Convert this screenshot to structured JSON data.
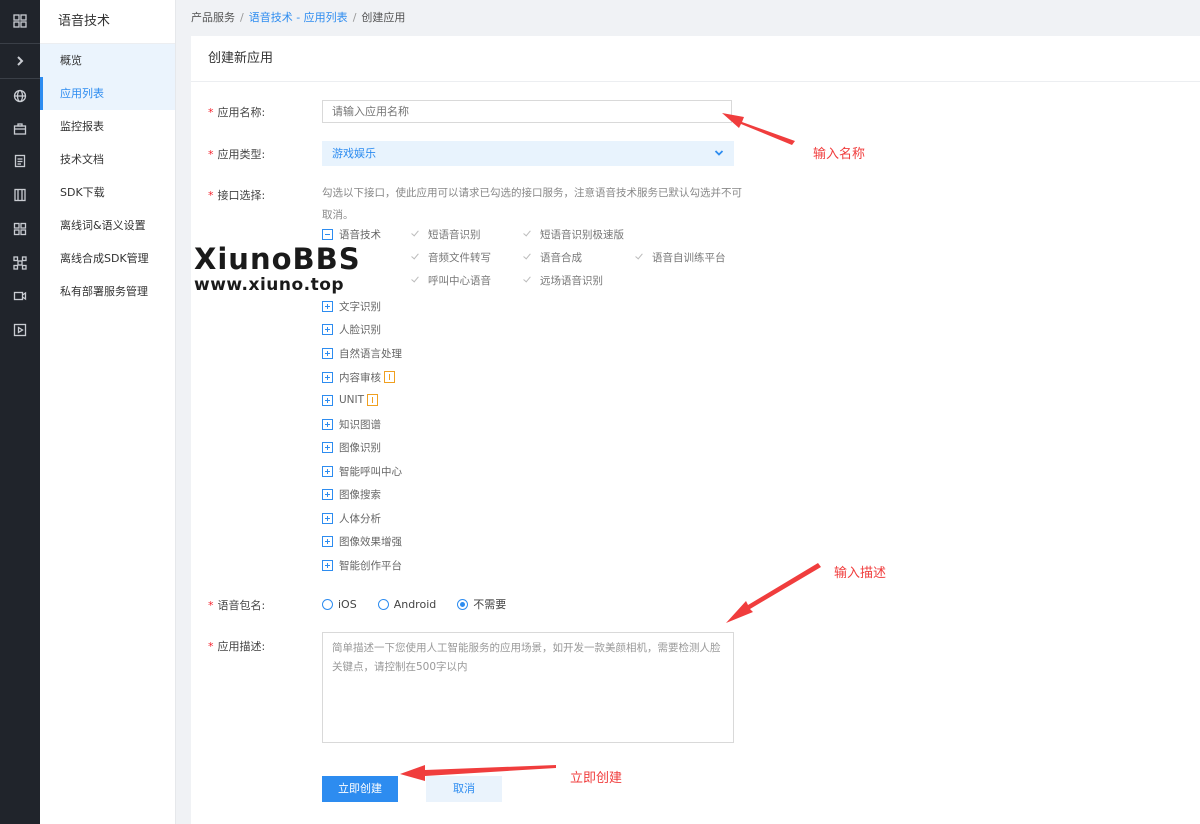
{
  "rail": {
    "icons": [
      "apps-grid-icon",
      "chevron-right-icon",
      "globe-icon",
      "briefcase-icon",
      "document-icon",
      "book-icon",
      "grid-icon",
      "network-icon",
      "video-icon",
      "play-icon"
    ]
  },
  "sidebar": {
    "title": "语音技术",
    "items": [
      {
        "label": "概览"
      },
      {
        "label": "应用列表"
      },
      {
        "label": "监控报表"
      },
      {
        "label": "技术文档"
      },
      {
        "label": "SDK下载"
      },
      {
        "label": "离线词&语义设置"
      },
      {
        "label": "离线合成SDK管理"
      },
      {
        "label": "私有部署服务管理"
      }
    ]
  },
  "breadcrumb": {
    "root": "产品服务",
    "section": "语音技术 - 应用列表",
    "current": "创建应用",
    "separator": "/"
  },
  "form": {
    "title": "创建新应用",
    "required_mark": "*",
    "name_label": "应用名称:",
    "name_placeholder": "请输入应用名称",
    "type_label": "应用类型:",
    "type_value": "游戏娱乐",
    "api_label": "接口选择:",
    "api_hint": "勾选以下接口，使此应用可以请求已勾选的接口服务，注意语音技术服务已默认勾选并不可取消。",
    "api_tree": {
      "expanded": {
        "label": "语音技术",
        "options": [
          "短语音识别",
          "短语音识别极速版",
          "音频文件转写",
          "语音合成",
          "语音自训练平台",
          "呼叫中心语音",
          "远场语音识别"
        ]
      },
      "collapsed": [
        "文字识别",
        "人脸识别",
        "自然语言处理",
        "内容审核",
        "UNIT",
        "知识图谱",
        "图像识别",
        "智能呼叫中心",
        "图像搜索",
        "人体分析",
        "图像效果增强",
        "智能创作平台"
      ]
    },
    "package_label": "语音包名:",
    "package_options": [
      "iOS",
      "Android",
      "不需要"
    ],
    "package_selected": "不需要",
    "desc_label": "应用描述:",
    "desc_placeholder": "简单描述一下您使用人工智能服务的应用场景，如开发一款美颜相机，需要检测人脸关键点，请控制在500字以内",
    "submit_label": "立即创建",
    "cancel_label": "取消"
  },
  "annotations": {
    "name": "输入名称",
    "desc": "输入描述",
    "create": "立即创建",
    "color": "#f03d3d"
  },
  "watermark": {
    "title": "XiunoBBS",
    "url": "www.xiuno.top"
  },
  "colors": {
    "accent": "#2d8cf0",
    "rail": "#20242b",
    "required": "#f5222d",
    "warning": "#f0a020"
  }
}
